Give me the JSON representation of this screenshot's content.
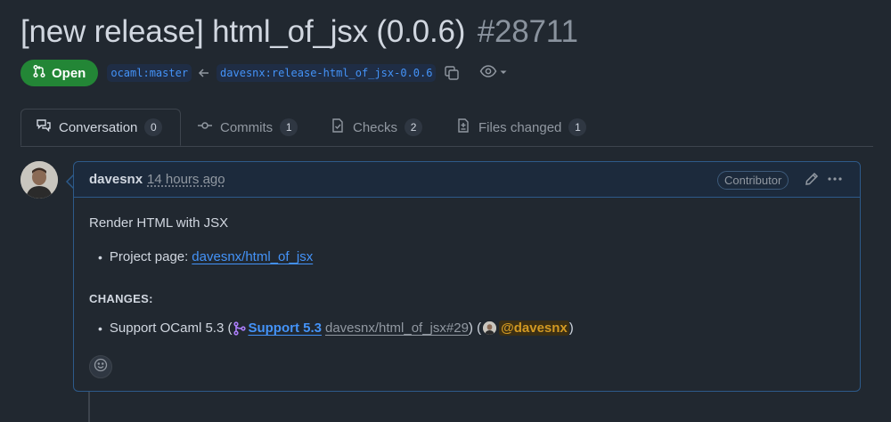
{
  "pr": {
    "title": "[new release] html_of_jsx (0.0.6)",
    "number": "#28711",
    "status": "Open",
    "base_branch": "ocaml:master",
    "head_branch": "davesnx:release-html_of_jsx-0.0.6"
  },
  "tabs": [
    {
      "label": "Conversation",
      "count": "0",
      "icon": "conversation-icon"
    },
    {
      "label": "Commits",
      "count": "1",
      "icon": "commit-icon"
    },
    {
      "label": "Checks",
      "count": "2",
      "icon": "checks-icon"
    },
    {
      "label": "Files changed",
      "count": "1",
      "icon": "file-diff-icon"
    }
  ],
  "comment": {
    "author": "davesnx",
    "time": "14 hours ago",
    "role": "Contributor",
    "intro": "Render HTML with JSX",
    "project_label": "Project page: ",
    "project_link": "davesnx/html_of_jsx",
    "changes_heading": "CHANGES:",
    "change_text": "Support OCaml 5.3 (",
    "pr_title": "Support 5.3",
    "pr_ref": "davesnx/html_of_jsx#29",
    "mid": ") (",
    "mention": "@davesnx",
    "close": ")"
  },
  "colors": {
    "background": "#212830",
    "open_green": "#238636",
    "link_blue": "#4493f8",
    "mention_orange": "#d29922",
    "merged_purple": "#ab7df8"
  }
}
